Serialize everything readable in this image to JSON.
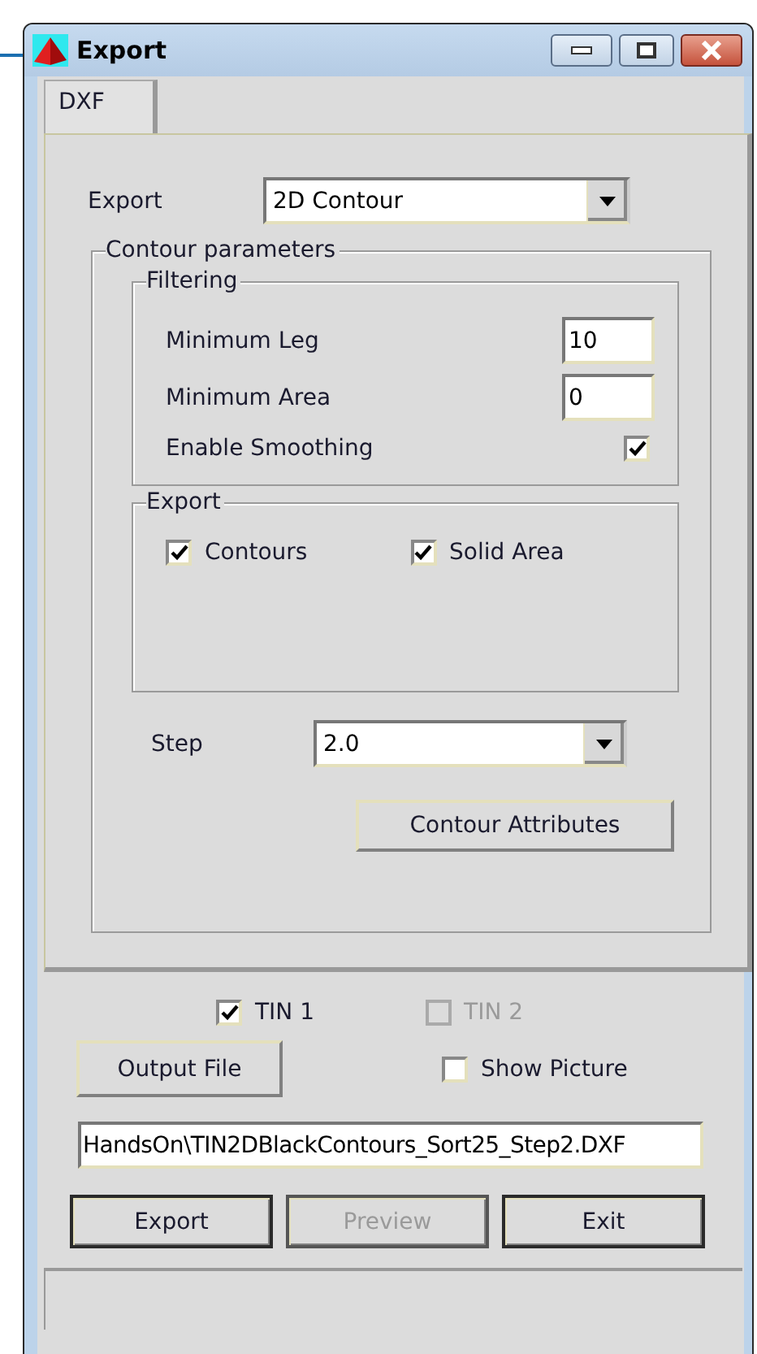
{
  "window": {
    "title": "Export"
  },
  "tabs": [
    {
      "label": "DXF",
      "selected": true
    }
  ],
  "export": {
    "label": "Export",
    "value": "2D Contour"
  },
  "contour_parameters": {
    "title": "Contour parameters",
    "filtering": {
      "title": "Filtering",
      "fields": [
        {
          "label": "Minimum Leg",
          "value": "10"
        },
        {
          "label": "Minimum Area",
          "value": "0"
        }
      ],
      "smoothing": {
        "label": "Enable Smoothing",
        "checked": true
      }
    },
    "export_group": {
      "title": "Export",
      "options": [
        {
          "label": "Contours",
          "checked": true
        },
        {
          "label": "Solid Area",
          "checked": true
        }
      ]
    },
    "step": {
      "label": "Step",
      "value": "2.0"
    },
    "attributes_button": "Contour Attributes"
  },
  "tins": [
    {
      "label": "TIN 1",
      "checked": true,
      "disabled": false
    },
    {
      "label": "TIN 2",
      "checked": false,
      "disabled": true
    }
  ],
  "output_file_button": "Output File",
  "show_picture": {
    "label": "Show Picture",
    "checked": false
  },
  "file_path": "HandsOn\\TIN2DBlackContours_Sort25_Step2.DXF",
  "buttons": [
    {
      "label": "Export",
      "disabled": false
    },
    {
      "label": "Preview",
      "disabled": true
    },
    {
      "label": "Exit",
      "disabled": false
    }
  ]
}
